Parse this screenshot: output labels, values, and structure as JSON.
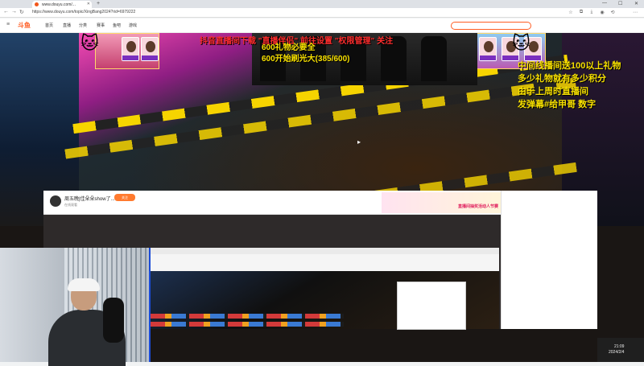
{
  "browser": {
    "tab_title": "www.douyu.com/...",
    "url": "https://www.douyu.com/topic/XingBang2024?rid=6979222",
    "icons": [
      "back-icon",
      "forward-icon",
      "refresh-icon",
      "home-icon",
      "star-icon",
      "menu-icon"
    ]
  },
  "site": {
    "logo": "斗鱼",
    "nav": [
      "首页",
      "直播",
      "分类",
      "赛事",
      "鱼吧",
      "游戏"
    ]
  },
  "overlay": {
    "title": "抖音直播间下载 \"直播伴侣\" 前往设置 \"权限管理\" 关注",
    "count_line": "600礼物必要全",
    "fire_line": "600开始刷光大(385/600)",
    "rules": [
      "中间线播间送100以上礼物",
      "多少礼物就有多少积分",
      "由于上周时直播间",
      "发弹幕#给甲哥 数字"
    ]
  },
  "capture": {
    "title": "周五晚|佳朵朵show了...",
    "subtitle": "在线观看",
    "follow_label": "关注",
    "banner_text": "直播间抽奖活动人节赛"
  },
  "taskbar": {
    "time": "21:09",
    "date": "2024/2/4"
  },
  "colors": {
    "accent": "#ff5d23",
    "overlay_yellow": "#f7e000"
  }
}
